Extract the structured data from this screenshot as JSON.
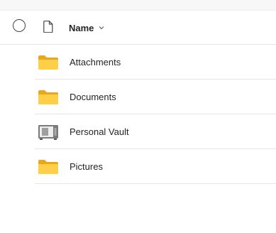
{
  "header": {
    "name_column": "Name"
  },
  "items": [
    {
      "label": "Attachments",
      "icon": "folder-icon"
    },
    {
      "label": "Documents",
      "icon": "folder-icon"
    },
    {
      "label": "Personal Vault",
      "icon": "vault-icon"
    },
    {
      "label": "Pictures",
      "icon": "folder-icon"
    }
  ],
  "colors": {
    "folder_back": "#E8A818",
    "folder_front": "#FFCF48",
    "vault_body": "#7A7A7A",
    "divider": "#E6E6E6"
  }
}
